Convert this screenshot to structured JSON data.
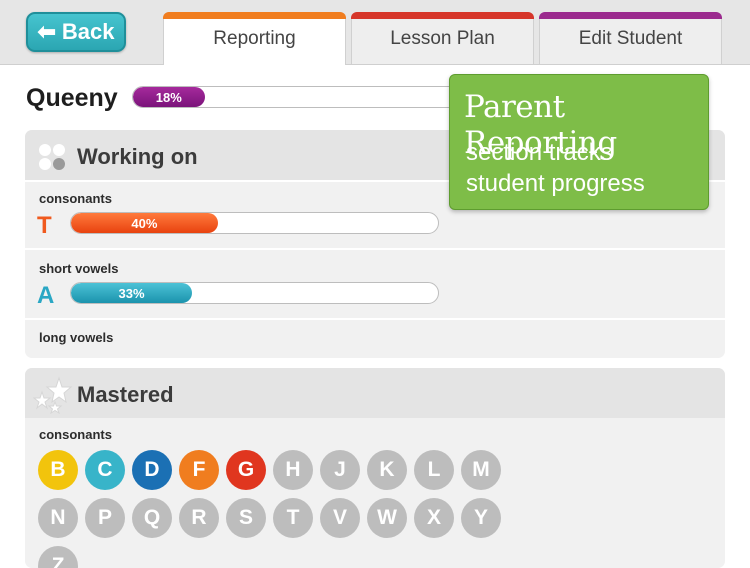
{
  "nav": {
    "back_label": "Back",
    "tabs": [
      {
        "label": "Reporting",
        "accent": "#f07d1f",
        "active": true
      },
      {
        "label": "Lesson Plan",
        "accent": "#d6362a",
        "active": false
      },
      {
        "label": "Edit Student",
        "accent": "#9b2a8e",
        "active": false
      }
    ]
  },
  "student": {
    "name": "Queeny",
    "progress": 0.18,
    "progress_label": "18%",
    "bar_color": "#8a1a82"
  },
  "promo": {
    "title": "Parent Reporting",
    "subtitle_line1": "section tracks",
    "subtitle_line2": "student progress"
  },
  "working_on": {
    "title": "Working on",
    "categories": [
      {
        "name": "consonants",
        "letter": "T",
        "progress": 0.4,
        "progress_label": "40%",
        "color": "#f05a1e"
      },
      {
        "name": "short vowels",
        "letter": "A",
        "progress": 0.33,
        "progress_label": "33%",
        "color": "#2aa7c4"
      },
      {
        "name": "long vowels"
      }
    ]
  },
  "mastered": {
    "title": "Mastered",
    "category": "consonants",
    "letters": [
      {
        "letter": "B",
        "color": "#f2c40c"
      },
      {
        "letter": "C",
        "color": "#38b4c9"
      },
      {
        "letter": "D",
        "color": "#1b70b4"
      },
      {
        "letter": "F",
        "color": "#f07d1f"
      },
      {
        "letter": "G",
        "color": "#e0361f"
      },
      {
        "letter": "H",
        "color": "#bdbdbd"
      },
      {
        "letter": "J",
        "color": "#bdbdbd"
      },
      {
        "letter": "K",
        "color": "#bdbdbd"
      },
      {
        "letter": "L",
        "color": "#bdbdbd"
      },
      {
        "letter": "M",
        "color": "#bdbdbd"
      },
      {
        "letter": "N",
        "color": "#bdbdbd"
      },
      {
        "letter": "P",
        "color": "#bdbdbd"
      },
      {
        "letter": "Q",
        "color": "#bdbdbd"
      },
      {
        "letter": "R",
        "color": "#bdbdbd"
      },
      {
        "letter": "S",
        "color": "#bdbdbd"
      },
      {
        "letter": "T",
        "color": "#bdbdbd"
      },
      {
        "letter": "V",
        "color": "#bdbdbd"
      },
      {
        "letter": "W",
        "color": "#bdbdbd"
      },
      {
        "letter": "X",
        "color": "#bdbdbd"
      },
      {
        "letter": "Y",
        "color": "#bdbdbd"
      },
      {
        "letter": "Z",
        "color": "#bdbdbd"
      }
    ]
  }
}
